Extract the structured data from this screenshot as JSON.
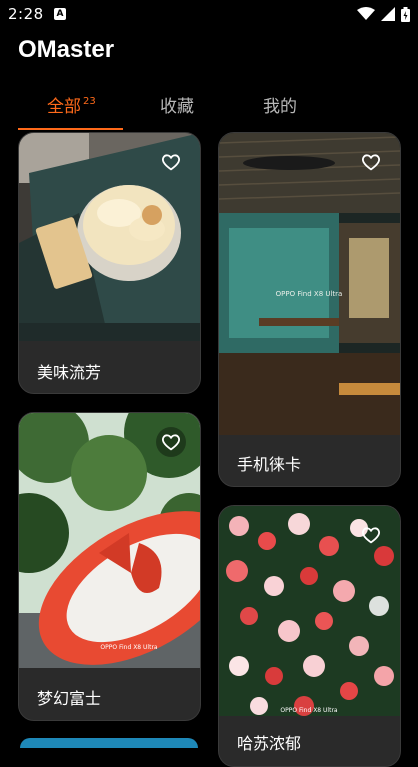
{
  "status_bar": {
    "time": "2:28",
    "notification_letter": "A"
  },
  "app": {
    "title": "OMaster"
  },
  "tabs": [
    {
      "label": "全部",
      "badge": "23",
      "active": true
    },
    {
      "label": "收藏",
      "active": false
    },
    {
      "label": "我的",
      "active": false
    }
  ],
  "cards": [
    {
      "title": "美味流芳",
      "image": "food-dessert-photo",
      "icon": "heart-outline-icon"
    },
    {
      "title": "手机徕卡",
      "image": "cafe-interior-photo",
      "icon": "heart-outline-icon"
    },
    {
      "title": "梦幻富士",
      "image": "red-sign-trees-photo",
      "icon": "heart-outline-icon"
    },
    {
      "title": "哈苏浓郁",
      "image": "flower-wall-photo",
      "icon": "heart-outline-icon"
    }
  ],
  "colors": {
    "accent": "#ff6a1a",
    "background": "#000000",
    "card": "#2a2a2a"
  }
}
